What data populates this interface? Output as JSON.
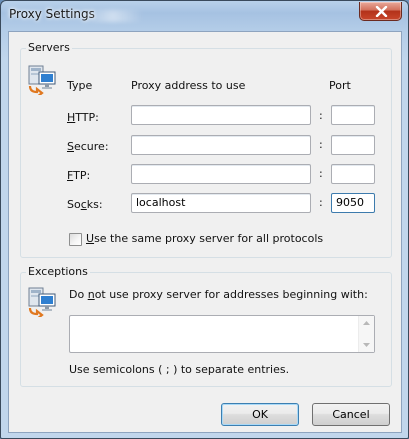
{
  "window": {
    "title": "Proxy Settings"
  },
  "servers": {
    "legend": "Servers",
    "col_type": "Type",
    "col_address": "Proxy address to use",
    "col_port": "Port",
    "colon": ":",
    "rows": [
      {
        "label_accel": "H",
        "label_rest": "TTP:",
        "address": "",
        "port": ""
      },
      {
        "label_accel": "S",
        "label_rest": "ecure:",
        "address": "",
        "port": ""
      },
      {
        "label_accel": "F",
        "label_rest": "TP:",
        "address": "",
        "port": ""
      },
      {
        "label_pre": "So",
        "label_accel": "c",
        "label_rest": "ks:",
        "address": "localhost",
        "port": "9050"
      }
    ],
    "same_proxy": {
      "accel": "U",
      "rest": "se the same proxy server for all protocols",
      "checked": false
    }
  },
  "exceptions": {
    "legend": "Exceptions",
    "intro_pre": "Do ",
    "intro_accel": "n",
    "intro_rest": "ot use proxy server for addresses beginning with:",
    "value": "",
    "hint": "Use semicolons ( ; ) to separate entries."
  },
  "buttons": {
    "ok": "OK",
    "cancel": "Cancel"
  },
  "icons": {
    "servers": "network-computer-icon",
    "exceptions": "network-computer-icon",
    "close": "close-icon"
  }
}
